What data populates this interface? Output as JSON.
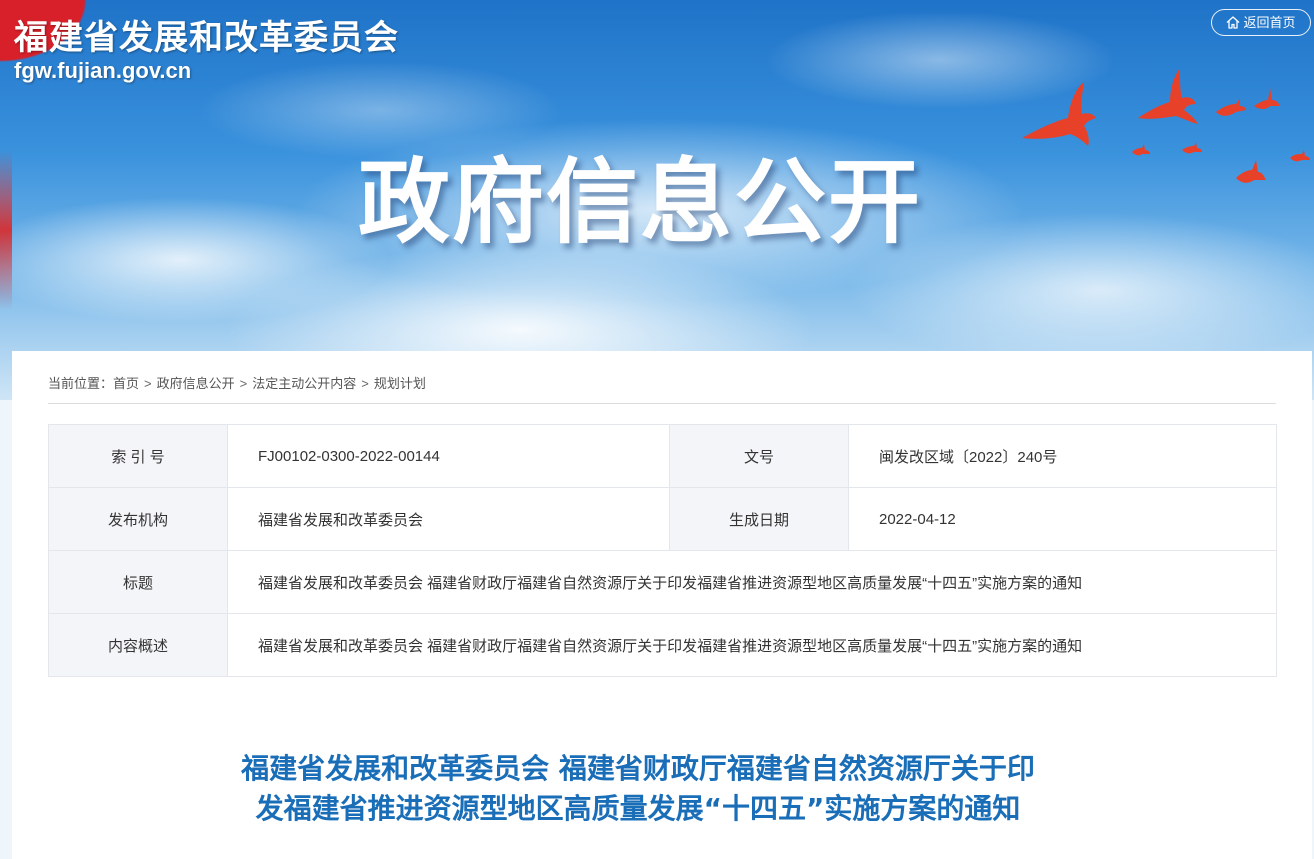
{
  "header": {
    "site_name": "福建省发展和改革委员会",
    "site_domain": "fgw.fujian.gov.cn",
    "back_home_label": "返回首页",
    "banner_title": "政府信息公开"
  },
  "breadcrumb": {
    "prefix": "当前位置：",
    "items": [
      "首页",
      "政府信息公开",
      "法定主动公开内容",
      "规划计划"
    ],
    "separator": ">"
  },
  "meta": {
    "index_no_label": "索 引 号",
    "index_no": "FJ00102-0300-2022-00144",
    "doc_no_label": "文号",
    "doc_no": "闽发改区域〔2022〕240号",
    "publisher_label": "发布机构",
    "publisher": "福建省发展和改革委员会",
    "date_label": "生成日期",
    "date": "2022-04-12",
    "title_label": "标题",
    "title": "福建省发展和改革委员会 福建省财政厅福建省自然资源厅关于印发福建省推进资源型地区高质量发展“十四五”实施方案的通知",
    "summary_label": "内容概述",
    "summary": "福建省发展和改革委员会 福建省财政厅福建省自然资源厅关于印发福建省推进资源型地区高质量发展“十四五”实施方案的通知"
  },
  "article": {
    "title_line1": "福建省发展和改革委员会 福建省财政厅福建省自然资源厅关于印",
    "title_line2": "发福建省推进资源型地区高质量发展“十四五”实施方案的通知"
  },
  "colors": {
    "article_title": "#1a6eb8",
    "table_label_bg": "#f4f5f8",
    "banner_red": "#d8202a"
  }
}
